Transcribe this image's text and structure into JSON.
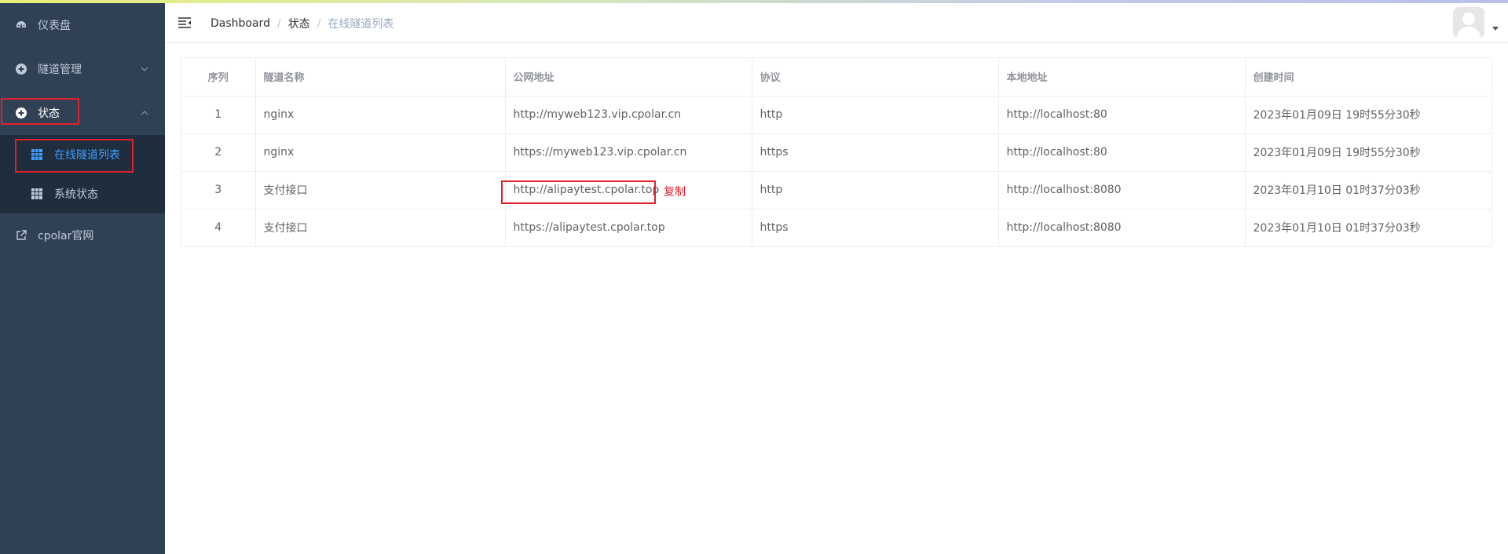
{
  "sidebar": {
    "items": [
      {
        "label": "仪表盘"
      },
      {
        "label": "隧道管理"
      },
      {
        "label": "状态"
      },
      {
        "label": "cpolar官网"
      }
    ],
    "submenu": [
      {
        "label": "在线隧道列表"
      },
      {
        "label": "系统状态"
      }
    ]
  },
  "breadcrumb": {
    "items": [
      "Dashboard",
      "状态",
      "在线隧道列表"
    ],
    "separator": "/"
  },
  "table": {
    "headers": [
      "序列",
      "隧道名称",
      "公网地址",
      "协议",
      "本地地址",
      "创建时间"
    ],
    "rows": [
      [
        "1",
        "nginx",
        "http://myweb123.vip.cpolar.cn",
        "http",
        "http://localhost:80",
        "2023年01月09日 19时55分30秒"
      ],
      [
        "2",
        "nginx",
        "https://myweb123.vip.cpolar.cn",
        "https",
        "http://localhost:80",
        "2023年01月09日 19时55分30秒"
      ],
      [
        "3",
        "支付接口",
        "http://alipaytest.cpolar.top",
        "http",
        "http://localhost:8080",
        "2023年01月10日 01时37分03秒"
      ],
      [
        "4",
        "支付接口",
        "https://alipaytest.cpolar.top",
        "https",
        "http://localhost:8080",
        "2023年01月10日 01时37分03秒"
      ]
    ]
  },
  "copy_label": "复制",
  "colors": {
    "sidebar_bg": "#304156",
    "submenu_bg": "#1f2d3d",
    "active": "#409eff",
    "highlight": "#e0202c"
  }
}
